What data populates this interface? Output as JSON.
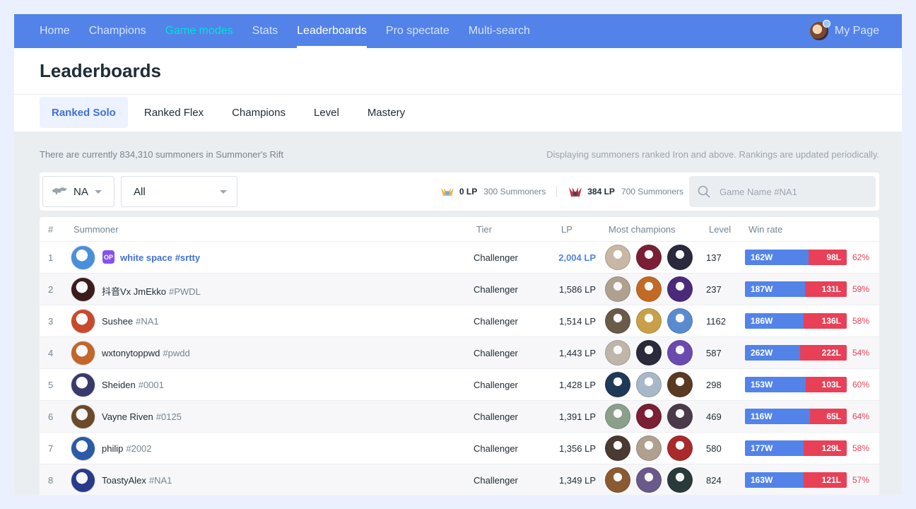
{
  "nav": {
    "items": [
      {
        "label": "Home",
        "state": "normal"
      },
      {
        "label": "Champions",
        "state": "normal"
      },
      {
        "label": "Game modes",
        "state": "highlight"
      },
      {
        "label": "Stats",
        "state": "normal"
      },
      {
        "label": "Leaderboards",
        "state": "active"
      },
      {
        "label": "Pro spectate",
        "state": "normal"
      },
      {
        "label": "Multi-search",
        "state": "normal"
      }
    ],
    "my_page": "My Page"
  },
  "page_title": "Leaderboards",
  "subtabs": [
    {
      "label": "Ranked Solo",
      "active": true
    },
    {
      "label": "Ranked Flex",
      "active": false
    },
    {
      "label": "Champions",
      "active": false
    },
    {
      "label": "Level",
      "active": false
    },
    {
      "label": "Mastery",
      "active": false
    }
  ],
  "info": {
    "summoner_count_text": "There are currently 834,310 summoners in Summoner's Rift",
    "note_text": "Displaying summoners ranked Iron and above. Rankings are updated periodically."
  },
  "filters": {
    "region": "NA",
    "tier": "All",
    "cutoffs": [
      {
        "emblem": "grandmaster-emblem-icon",
        "lp": "0 LP",
        "summoners": "300 Summoners"
      },
      {
        "emblem": "master-emblem-icon",
        "lp": "384 LP",
        "summoners": "700 Summoners"
      }
    ],
    "search_placeholder": "Game Name #NA1"
  },
  "table": {
    "headers": {
      "rank": "#",
      "summoner": "Summoner",
      "tier": "Tier",
      "lp": "LP",
      "champions": "Most champions",
      "level": "Level",
      "winrate": "Win rate"
    },
    "rows": [
      {
        "rank": "1",
        "name": "white space",
        "tag": "#srtty",
        "op_badge": "OP",
        "tier": "Challenger",
        "lp": "2,004 LP",
        "champions": [
          {
            "color": "#c9b7a6"
          },
          {
            "color": "#7a1f35"
          },
          {
            "color": "#2a2a3c"
          }
        ],
        "level": "137",
        "wins": "162W",
        "losses": "98L",
        "win_share": 0.623,
        "pct": "62%",
        "avatar_color": "#4a8fd9"
      },
      {
        "rank": "2",
        "name": "抖音Vx JmEkko",
        "tag": "#PWDL",
        "tier": "Challenger",
        "lp": "1,586 LP",
        "champions": [
          {
            "color": "#b0a090"
          },
          {
            "color": "#c26a24"
          },
          {
            "color": "#4b2a7c"
          }
        ],
        "level": "237",
        "wins": "187W",
        "losses": "131L",
        "win_share": 0.588,
        "pct": "59%",
        "avatar_color": "#3b1c1c"
      },
      {
        "rank": "3",
        "name": "Sushee",
        "tag": "#NA1",
        "tier": "Challenger",
        "lp": "1,514 LP",
        "champions": [
          {
            "color": "#6a5a48"
          },
          {
            "color": "#c9a04a"
          },
          {
            "color": "#5a8bd0"
          }
        ],
        "level": "1162",
        "wins": "186W",
        "losses": "136L",
        "win_share": 0.578,
        "pct": "58%",
        "avatar_color": "#c84a2a"
      },
      {
        "rank": "4",
        "name": "wxtonytoppwd",
        "tag": "#pwdd",
        "tier": "Challenger",
        "lp": "1,443 LP",
        "champions": [
          {
            "color": "#bfb5a8"
          },
          {
            "color": "#2a2a3c"
          },
          {
            "color": "#6b4ab0"
          }
        ],
        "level": "587",
        "wins": "262W",
        "losses": "222L",
        "win_share": 0.541,
        "pct": "54%",
        "avatar_color": "#c2662a"
      },
      {
        "rank": "5",
        "name": "Sheiden",
        "tag": "#0001",
        "tier": "Challenger",
        "lp": "1,428 LP",
        "champions": [
          {
            "color": "#1f3a58"
          },
          {
            "color": "#a8b8c8"
          },
          {
            "color": "#5a3a22"
          }
        ],
        "level": "298",
        "wins": "153W",
        "losses": "103L",
        "win_share": 0.598,
        "pct": "60%",
        "avatar_color": "#3a3a6a"
      },
      {
        "rank": "6",
        "name": "Vayne Riven",
        "tag": "#0125",
        "tier": "Challenger",
        "lp": "1,391 LP",
        "champions": [
          {
            "color": "#8aa08a"
          },
          {
            "color": "#7a1f35"
          },
          {
            "color": "#4a3a4a"
          }
        ],
        "level": "469",
        "wins": "116W",
        "losses": "65L",
        "win_share": 0.641,
        "pct": "64%",
        "avatar_color": "#6a4a2a"
      },
      {
        "rank": "7",
        "name": "philip",
        "tag": "#2002",
        "tier": "Challenger",
        "lp": "1,356 LP",
        "champions": [
          {
            "color": "#4a3a32"
          },
          {
            "color": "#b0a090"
          },
          {
            "color": "#a82a2a"
          }
        ],
        "level": "580",
        "wins": "177W",
        "losses": "129L",
        "win_share": 0.578,
        "pct": "58%",
        "avatar_color": "#2a5aa8"
      },
      {
        "rank": "8",
        "name": "ToastyAlex",
        "tag": "#NA1",
        "tier": "Challenger",
        "lp": "1,349 LP",
        "champions": [
          {
            "color": "#8a5a32"
          },
          {
            "color": "#6a5a8a"
          },
          {
            "color": "#2a3a3a"
          }
        ],
        "level": "824",
        "wins": "163W",
        "losses": "121L",
        "win_share": 0.574,
        "pct": "57%",
        "avatar_color": "#2a3a8a"
      }
    ]
  },
  "colors": {
    "nav_bg": "#5383e8",
    "win": "#5383e8",
    "loss": "#e84057",
    "op_badge": "#8552ee",
    "accent_text": "#4171d6"
  }
}
